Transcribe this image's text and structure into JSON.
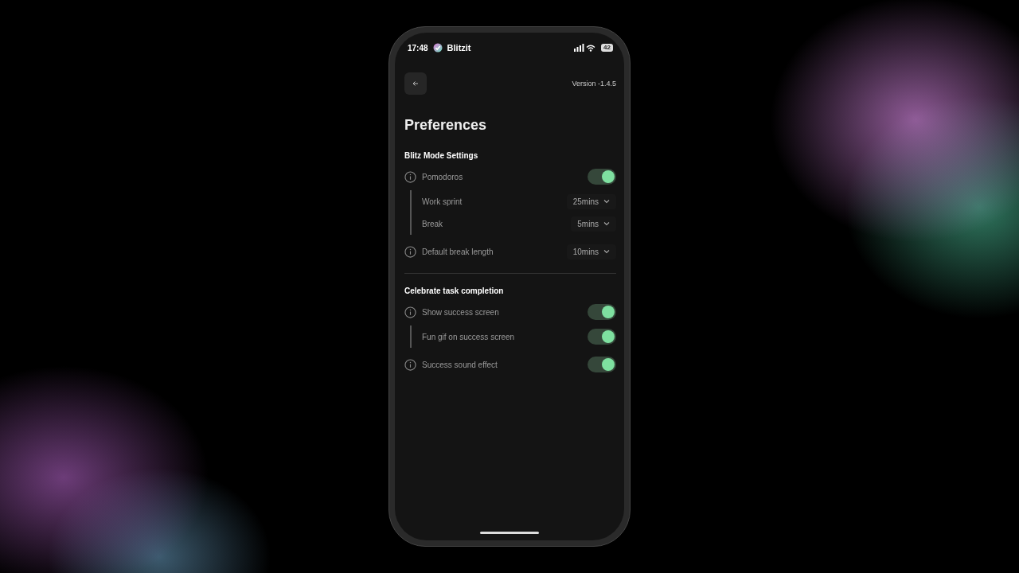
{
  "status_bar": {
    "time": "17:48",
    "app_name": "Blitzit",
    "battery": "42"
  },
  "header": {
    "version": "Version -1.4.5"
  },
  "title": "Preferences",
  "sections": [
    {
      "title": "Blitz Mode Settings",
      "rows": [
        {
          "kind": "toggle",
          "label": "Pomodoros",
          "info": true,
          "on": true,
          "children": [
            {
              "kind": "select",
              "label": "Work sprint",
              "value": "25mins"
            },
            {
              "kind": "select",
              "label": "Break",
              "value": "5mins"
            }
          ]
        },
        {
          "kind": "select",
          "label": "Default break length",
          "info": true,
          "value": "10mins"
        }
      ]
    },
    {
      "title": "Celebrate task completion",
      "rows": [
        {
          "kind": "toggle",
          "label": "Show success screen",
          "info": true,
          "on": true,
          "children": [
            {
              "kind": "toggle",
              "label": "Fun gif on success screen",
              "on": true
            }
          ]
        },
        {
          "kind": "toggle",
          "label": "Success sound effect",
          "info": true,
          "on": true
        }
      ]
    }
  ]
}
